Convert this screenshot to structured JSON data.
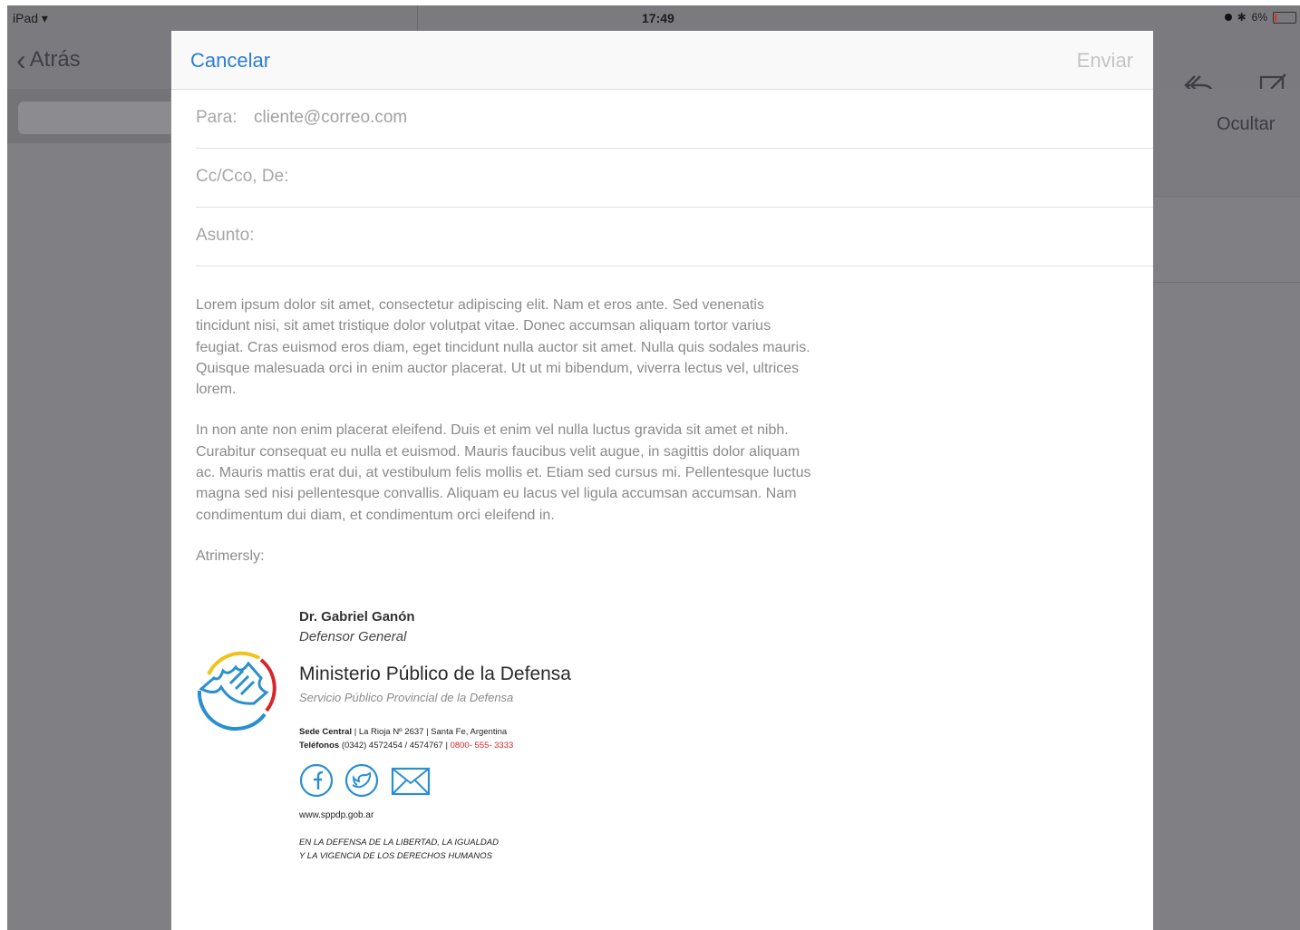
{
  "status_bar": {
    "carrier": "iPad",
    "time": "17:49",
    "battery": "6%"
  },
  "background_app": {
    "back_label": "Atrás",
    "hide_label": "Ocultar"
  },
  "compose": {
    "cancel_label": "Cancelar",
    "send_label": "Enviar",
    "to_label": "Para:",
    "to_value": "cliente@correo.com",
    "cc_label": "Cc/Cco, De:",
    "subject_label": "Asunto:",
    "body_paragraphs": [
      "Lorem ipsum dolor sit amet, consectetur adipiscing elit. Nam et eros ante. Sed venenatis tincidunt nisi, sit amet tristique dolor volutpat vitae. Donec accumsan aliquam tortor varius feugiat. Cras euismod eros diam, eget tincidunt nulla auctor sit amet. Nulla quis sodales mauris. Quisque malesuada orci in enim auctor placerat. Ut ut mi bibendum, viverra lectus vel, ultrices lorem.",
      "In non ante non enim placerat eleifend. Duis et enim vel nulla luctus gravida sit amet et nibh. Curabitur consequat eu nulla et euismod. Mauris faucibus velit augue, in sagittis dolor aliquam ac. Mauris mattis erat dui, at vestibulum felis mollis et. Etiam sed cursus mi. Pellentesque luctus magna sed nisi pellentesque convallis. Aliquam eu lacus vel ligula accumsan accumsan. Nam condimentum dui diam, et condimentum orci eleifend in."
    ],
    "closing": "Atrimersly:"
  },
  "signature": {
    "name": "Dr. Gabriel Ganón",
    "role": "Defensor General",
    "org": "Ministerio Público de la Defensa",
    "sub": "Servicio Público Provincial de la Defensa",
    "address_label": "Sede Central",
    "address": "| La Rioja Nº 2637 | Santa Fe, Argentina",
    "phone_label": "Teléfonos",
    "phones": "(0342) 4572454 / 4574767",
    "hotline": "0800- 555- 3333",
    "website": "www.sppdp.gob.ar",
    "motto_line1": "EN LA DEFENSA DE LA LIBERTAD, LA IGUALDAD",
    "motto_line2": "Y LA VIGENCIA DE LOS DERECHOS HUMANOS",
    "social_icons": [
      "facebook-icon",
      "twitter-icon",
      "email-icon"
    ]
  },
  "colors": {
    "accent": "#2b7fd6",
    "logo_blue": "#2a8fd0",
    "logo_yellow": "#f2c21a",
    "logo_red": "#d8262a"
  }
}
